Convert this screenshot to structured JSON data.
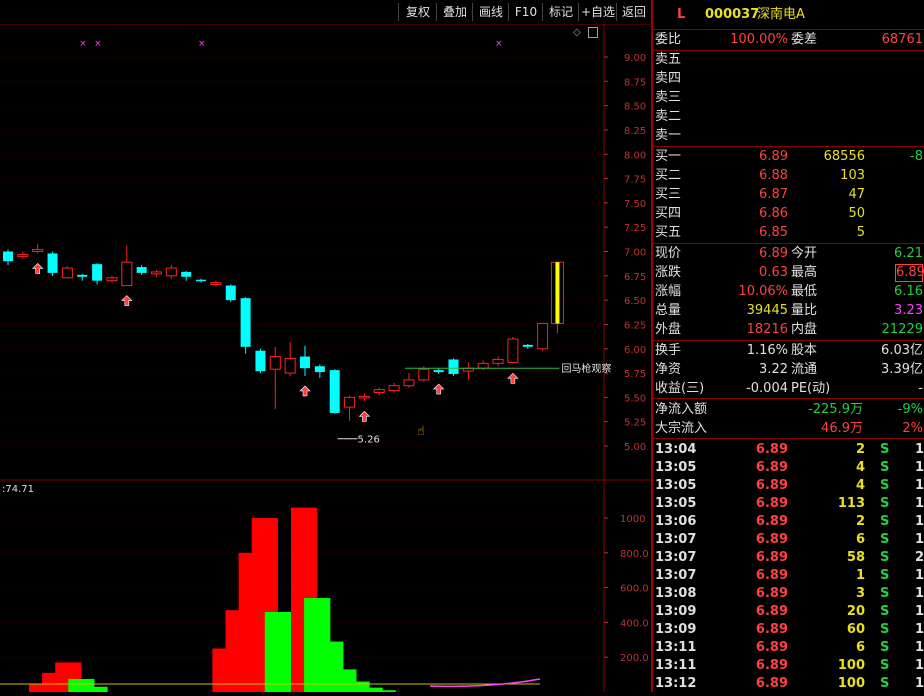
{
  "toolbar": {
    "buttons": [
      "复权",
      "叠加",
      "画线",
      "F10",
      "标记",
      "+自选",
      "返回"
    ]
  },
  "colors": {
    "up": "#ff2020",
    "down": "#00ffff",
    "volume_up": "#ff0000",
    "volume_down": "#00ff00",
    "axis": "#c03030",
    "limit_up_candle": "#ffff00"
  },
  "chart_data": [
    {
      "type": "candlestick",
      "ylim": [
        5.0,
        9.0
      ],
      "y_ticks": [
        "9.00",
        "8.75",
        "8.50",
        "8.25",
        "8.00",
        "7.75",
        "7.50",
        "7.25",
        "7.00",
        "6.75",
        "6.50",
        "6.25",
        "6.00",
        "5.75",
        "5.50",
        "5.25",
        "5.00"
      ],
      "candles": [
        {
          "o": 7.0,
          "c": 6.9,
          "h": 7.02,
          "l": 6.86
        },
        {
          "o": 6.95,
          "c": 6.97,
          "h": 7.0,
          "l": 6.92
        },
        {
          "o": 7.0,
          "c": 7.02,
          "h": 7.08,
          "l": 6.98
        },
        {
          "o": 6.98,
          "c": 6.78,
          "h": 7.0,
          "l": 6.75
        },
        {
          "o": 6.73,
          "c": 6.83,
          "h": 6.85,
          "l": 6.72
        },
        {
          "o": 6.76,
          "c": 6.74,
          "h": 6.77,
          "l": 6.7
        },
        {
          "o": 6.87,
          "c": 6.7,
          "h": 6.88,
          "l": 6.66
        },
        {
          "o": 6.7,
          "c": 6.73,
          "h": 6.75,
          "l": 6.68
        },
        {
          "o": 6.65,
          "c": 6.89,
          "h": 7.06,
          "l": 6.65
        },
        {
          "o": 6.84,
          "c": 6.78,
          "h": 6.86,
          "l": 6.76
        },
        {
          "o": 6.77,
          "c": 6.79,
          "h": 6.81,
          "l": 6.74
        },
        {
          "o": 6.75,
          "c": 6.83,
          "h": 6.86,
          "l": 6.72
        },
        {
          "o": 6.79,
          "c": 6.74,
          "h": 6.8,
          "l": 6.7
        },
        {
          "o": 6.71,
          "c": 6.7,
          "h": 6.72,
          "l": 6.68
        },
        {
          "o": 6.66,
          "c": 6.68,
          "h": 6.7,
          "l": 6.64
        },
        {
          "o": 6.65,
          "c": 6.5,
          "h": 6.66,
          "l": 6.48
        },
        {
          "o": 6.52,
          "c": 6.02,
          "h": 6.53,
          "l": 5.95
        },
        {
          "o": 5.98,
          "c": 5.77,
          "h": 6.0,
          "l": 5.75
        },
        {
          "o": 5.79,
          "c": 5.92,
          "h": 6.02,
          "l": 5.38
        },
        {
          "o": 5.75,
          "c": 5.9,
          "h": 6.07,
          "l": 5.72
        },
        {
          "o": 5.92,
          "c": 5.8,
          "h": 6.03,
          "l": 5.72
        },
        {
          "o": 5.82,
          "c": 5.76,
          "h": 5.84,
          "l": 5.7
        },
        {
          "o": 5.78,
          "c": 5.34,
          "h": 5.79,
          "l": 5.33
        },
        {
          "o": 5.4,
          "c": 5.5,
          "h": 5.52,
          "l": 5.26
        },
        {
          "o": 5.5,
          "c": 5.51,
          "h": 5.54,
          "l": 5.46
        },
        {
          "o": 5.55,
          "c": 5.58,
          "h": 5.6,
          "l": 5.52
        },
        {
          "o": 5.57,
          "c": 5.62,
          "h": 5.65,
          "l": 5.55
        },
        {
          "o": 5.62,
          "c": 5.68,
          "h": 5.75,
          "l": 5.6
        },
        {
          "o": 5.68,
          "c": 5.79,
          "h": 5.82,
          "l": 5.66
        },
        {
          "o": 5.78,
          "c": 5.76,
          "h": 5.8,
          "l": 5.74
        },
        {
          "o": 5.89,
          "c": 5.74,
          "h": 5.9,
          "l": 5.72
        },
        {
          "o": 5.77,
          "c": 5.8,
          "h": 5.86,
          "l": 5.68
        },
        {
          "o": 5.8,
          "c": 5.85,
          "h": 5.88,
          "l": 5.78
        },
        {
          "o": 5.85,
          "c": 5.89,
          "h": 5.92,
          "l": 5.82
        },
        {
          "o": 5.86,
          "c": 6.1,
          "h": 6.12,
          "l": 5.85
        },
        {
          "o": 6.04,
          "c": 6.02,
          "h": 6.05,
          "l": 6.0
        },
        {
          "o": 6.0,
          "c": 6.26,
          "h": 6.27,
          "l": 5.98
        },
        {
          "o": 6.26,
          "c": 6.89,
          "h": 6.89,
          "l": 6.16
        }
      ],
      "up_arrow_indices": [
        2,
        8,
        20,
        24,
        29,
        34
      ],
      "support_line": {
        "value": 5.8,
        "from_index": 27,
        "to_index": 37,
        "label": "回马枪观察"
      },
      "low_label": "5.26",
      "low_label_index": 23,
      "top_marks": [
        5,
        6,
        13,
        33
      ]
    },
    {
      "type": "bar",
      "title": "74.71",
      "ylim": [
        0,
        1200
      ],
      "y_ticks": [
        "1000",
        "800.0",
        "600.0",
        "400.0",
        "200.0"
      ],
      "bars": [
        {
          "value": 45,
          "color": "red"
        },
        {
          "value": 110,
          "color": "red"
        },
        {
          "value": 170,
          "color": "red"
        },
        {
          "value": 75,
          "color": "green"
        },
        {
          "value": 30,
          "color": "green"
        },
        {
          "value": 0,
          "color": "red"
        },
        {
          "value": 0,
          "color": "red"
        },
        {
          "value": 0,
          "color": "red"
        },
        {
          "value": 0,
          "color": "red"
        },
        {
          "value": 0,
          "color": "red"
        },
        {
          "value": 0,
          "color": "red"
        },
        {
          "value": 0,
          "color": "red"
        },
        {
          "value": 0,
          "color": "red"
        },
        {
          "value": 0,
          "color": "red"
        },
        {
          "value": 250,
          "color": "red"
        },
        {
          "value": 470,
          "color": "red"
        },
        {
          "value": 800,
          "color": "red"
        },
        {
          "value": 1000,
          "color": "red"
        },
        {
          "value": 460,
          "color": "green"
        },
        {
          "value": 230,
          "color": "green"
        },
        {
          "value": 1060,
          "color": "red"
        },
        {
          "value": 540,
          "color": "green"
        },
        {
          "value": 290,
          "color": "green"
        },
        {
          "value": 130,
          "color": "green"
        },
        {
          "value": 60,
          "color": "green"
        },
        {
          "value": 25,
          "color": "green"
        },
        {
          "value": 10,
          "color": "green"
        }
      ]
    }
  ],
  "quote": {
    "flag": "L",
    "code": "000037",
    "name": "深南电A",
    "weibi_label": "委比",
    "weibi": "100.00%",
    "weicha_label": "委差",
    "weicha": "68761",
    "sell": [
      {
        "label": "卖五"
      },
      {
        "label": "卖四"
      },
      {
        "label": "卖三"
      },
      {
        "label": "卖二"
      },
      {
        "label": "卖一"
      }
    ],
    "buy": [
      {
        "label": "买一",
        "price": "6.89",
        "vol": "68556",
        "chg": "-8"
      },
      {
        "label": "买二",
        "price": "6.88",
        "vol": "103",
        "chg": ""
      },
      {
        "label": "买三",
        "price": "6.87",
        "vol": "47",
        "chg": ""
      },
      {
        "label": "买四",
        "price": "6.86",
        "vol": "50",
        "chg": ""
      },
      {
        "label": "买五",
        "price": "6.85",
        "vol": "5",
        "chg": ""
      }
    ],
    "stats": [
      {
        "l1": "现价",
        "v1": "6.89",
        "l2": "今开",
        "v2": "6.21"
      },
      {
        "l1": "涨跌",
        "v1": "0.63",
        "l2": "最高",
        "v2": "6.89"
      },
      {
        "l1": "涨幅",
        "v1": "10.06%",
        "l2": "最低",
        "v2": "6.16"
      },
      {
        "l1": "总量",
        "v1": "39445",
        "l2": "量比",
        "v2": "3.23"
      },
      {
        "l1": "外盘",
        "v1": "18216",
        "l2": "内盘",
        "v2": "21229"
      }
    ],
    "stats2": [
      {
        "l1": "换手",
        "v1": "1.16%",
        "l2": "股本",
        "v2": "6.03亿"
      },
      {
        "l1": "净资",
        "v1": "3.22",
        "l2": "流通",
        "v2": "3.39亿"
      },
      {
        "l1": "收益(三)",
        "v1": "-0.004",
        "l2": "PE(动)",
        "v2": "-"
      }
    ],
    "flow": [
      {
        "label": "净流入额",
        "value": "-225.9万",
        "pct": "-9%"
      },
      {
        "label": "大宗流入",
        "value": "46.9万",
        "pct": "2%"
      }
    ]
  },
  "ticks": [
    {
      "time": "13:04",
      "price": "6.89",
      "vol": "2",
      "side": "S",
      "n": "1"
    },
    {
      "time": "13:05",
      "price": "6.89",
      "vol": "4",
      "side": "S",
      "n": "1"
    },
    {
      "time": "13:05",
      "price": "6.89",
      "vol": "4",
      "side": "S",
      "n": "1"
    },
    {
      "time": "13:05",
      "price": "6.89",
      "vol": "113",
      "side": "S",
      "n": "1"
    },
    {
      "time": "13:06",
      "price": "6.89",
      "vol": "2",
      "side": "S",
      "n": "1"
    },
    {
      "time": "13:07",
      "price": "6.89",
      "vol": "6",
      "side": "S",
      "n": "1"
    },
    {
      "time": "13:07",
      "price": "6.89",
      "vol": "58",
      "side": "S",
      "n": "2"
    },
    {
      "time": "13:07",
      "price": "6.89",
      "vol": "1",
      "side": "S",
      "n": "1"
    },
    {
      "time": "13:08",
      "price": "6.89",
      "vol": "3",
      "side": "S",
      "n": "1"
    },
    {
      "time": "13:09",
      "price": "6.89",
      "vol": "20",
      "side": "S",
      "n": "1"
    },
    {
      "time": "13:09",
      "price": "6.89",
      "vol": "60",
      "side": "S",
      "n": "1"
    },
    {
      "time": "13:11",
      "price": "6.89",
      "vol": "6",
      "side": "S",
      "n": "1"
    },
    {
      "time": "13:11",
      "price": "6.89",
      "vol": "100",
      "side": "S",
      "n": "1"
    },
    {
      "time": "13:12",
      "price": "6.89",
      "vol": "100",
      "side": "S",
      "n": "1"
    }
  ]
}
